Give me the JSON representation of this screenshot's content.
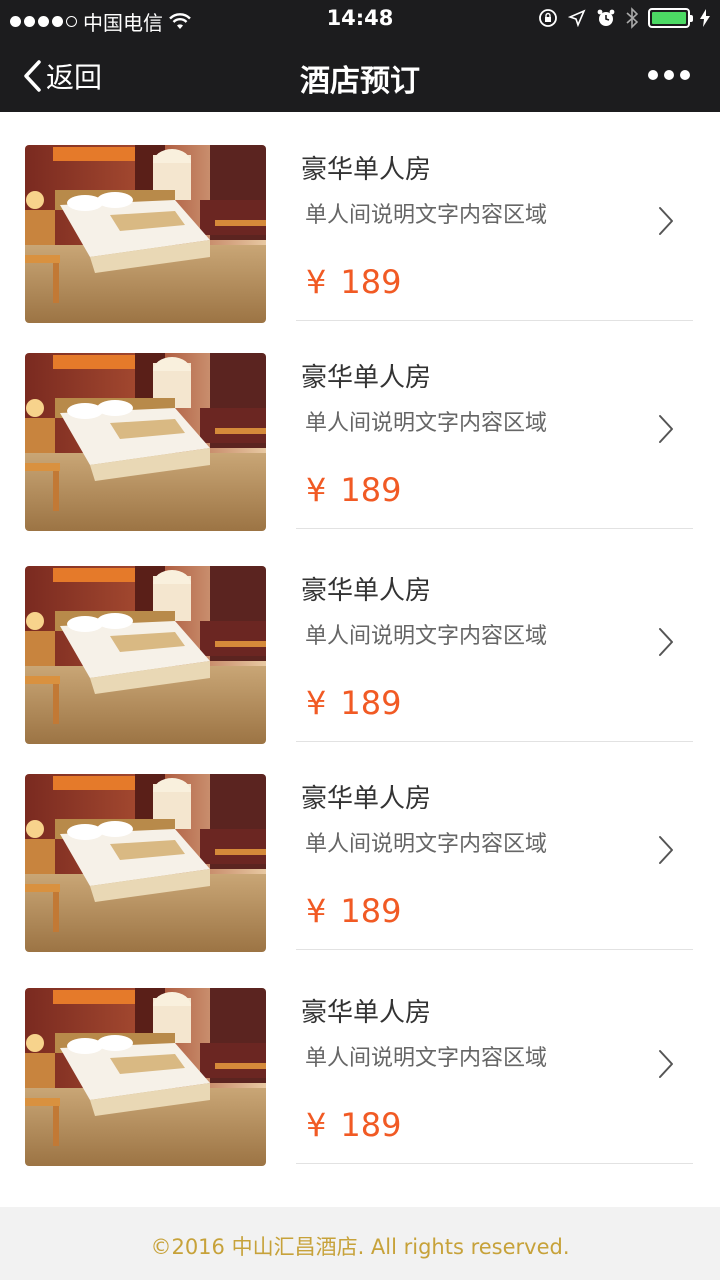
{
  "status": {
    "carrier": "中国电信",
    "time": "14:48"
  },
  "nav": {
    "back_label": "返回",
    "title": "酒店预订"
  },
  "rooms": [
    {
      "name": "豪华单人房",
      "desc": "单人间说明文字内容区域",
      "currency": "¥",
      "price": "189"
    },
    {
      "name": "豪华单人房",
      "desc": "单人间说明文字内容区域",
      "currency": "¥",
      "price": "189"
    },
    {
      "name": "豪华单人房",
      "desc": "单人间说明文字内容区域",
      "currency": "¥",
      "price": "189"
    },
    {
      "name": "豪华单人房",
      "desc": "单人间说明文字内容区域",
      "currency": "¥",
      "price": "189"
    },
    {
      "name": "豪华单人房",
      "desc": "单人间说明文字内容区域",
      "currency": "¥",
      "price": "189"
    }
  ],
  "footer": {
    "text": "©2016 中山汇昌酒店. All rights reserved."
  },
  "colors": {
    "bar": "#1c1c1e",
    "price": "#f15a24",
    "footer_text": "#c7a23a",
    "battery": "#4cd964"
  }
}
